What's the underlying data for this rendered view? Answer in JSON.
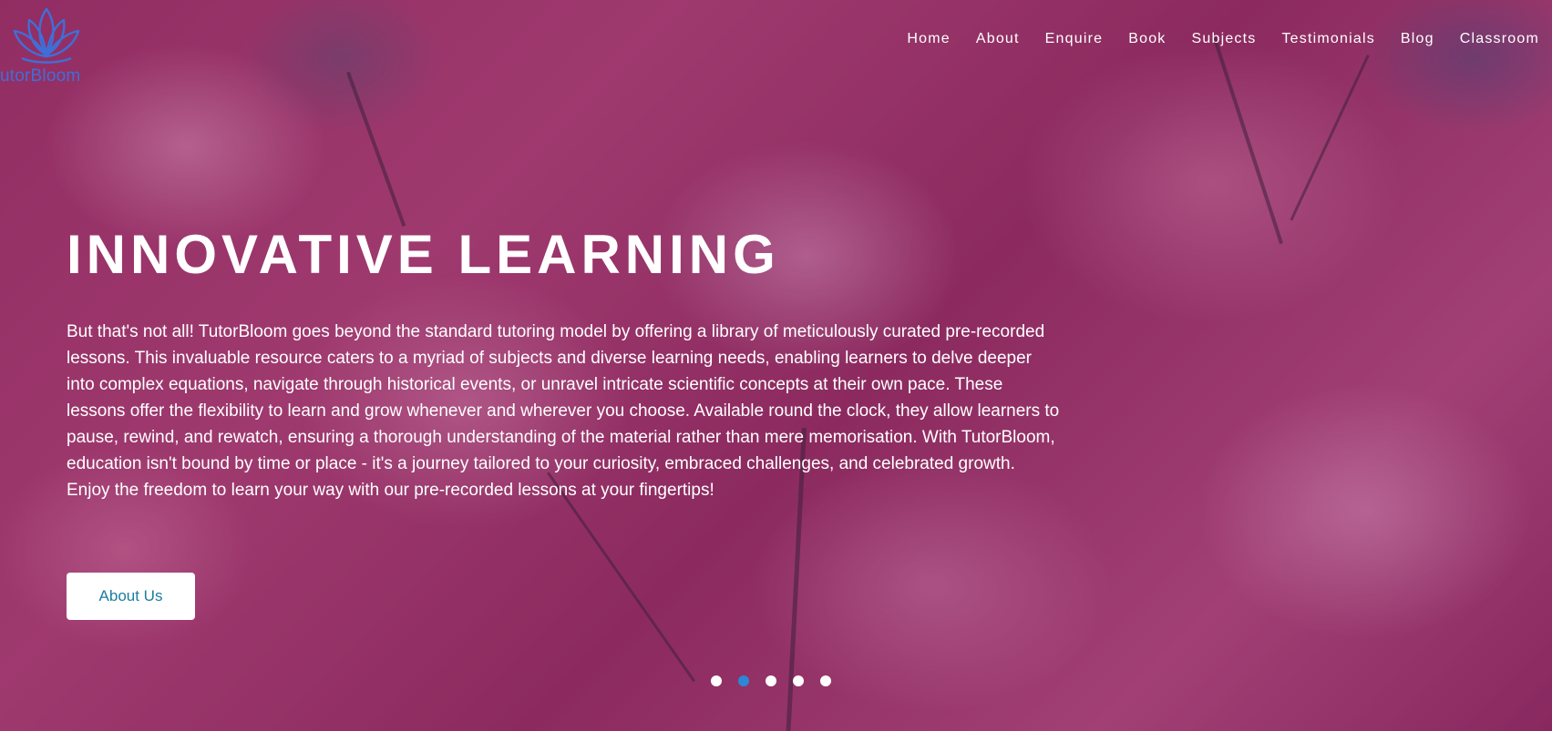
{
  "brand": {
    "logo_text": "utorBloom",
    "logo_icon": "lotus-icon",
    "logo_color": "#3f6fd6"
  },
  "nav": {
    "items": [
      {
        "label": "Home"
      },
      {
        "label": "About"
      },
      {
        "label": "Enquire"
      },
      {
        "label": "Book"
      },
      {
        "label": "Subjects"
      },
      {
        "label": "Testimonials"
      },
      {
        "label": "Blog"
      },
      {
        "label": "Classroom"
      }
    ]
  },
  "hero": {
    "headline": "INNOVATIVE LEARNING",
    "body": "But that's not all! TutorBloom goes beyond the standard tutoring model by offering a library of meticulously curated pre-recorded lessons. This invaluable resource caters to a myriad of subjects and diverse learning needs, enabling learners to delve deeper into complex equations, navigate through historical events, or unravel intricate scientific concepts at their own pace. These lessons offer the flexibility to learn and grow whenever and wherever you choose. Available round the clock, they allow learners to pause, rewind, and rewatch, ensuring a thorough understanding of the material rather than mere memorisation. With TutorBloom, education isn't bound by time or place - it's a journey tailored to your curiosity, embraced challenges, and celebrated growth. Enjoy the freedom to learn your way with our pre-recorded lessons at your fingertips!",
    "cta_label": "About Us",
    "cta_color": "#1b7da0"
  },
  "carousel": {
    "slide_count": 5,
    "active_index": 1,
    "active_color": "#2e86d6"
  }
}
